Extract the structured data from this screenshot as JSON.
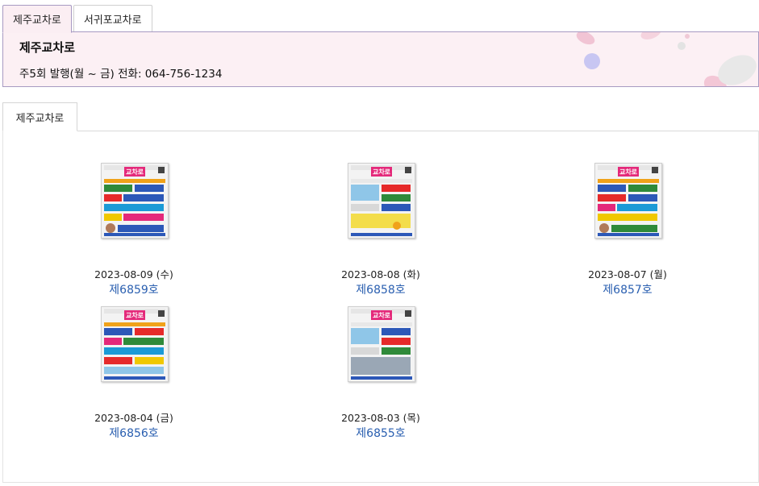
{
  "top_tabs": [
    {
      "label": "제주교차로",
      "active": true
    },
    {
      "label": "서귀포교차로",
      "active": false
    }
  ],
  "info": {
    "title": "제주교차로",
    "description": "주5회 발행(월 ~ 금) 전화: 064-756-1234"
  },
  "sub_tabs": [
    {
      "label": "제주교차로",
      "active": true
    }
  ],
  "issues": [
    {
      "date": "2023-08-09 (수)",
      "number": "제6859호",
      "cover_logo": "교차로"
    },
    {
      "date": "2023-08-08 (화)",
      "number": "제6858호",
      "cover_logo": "교차로"
    },
    {
      "date": "2023-08-07 (월)",
      "number": "제6857호",
      "cover_logo": "교차로"
    },
    {
      "date": "2023-08-04 (금)",
      "number": "제6856호",
      "cover_logo": "교차로"
    },
    {
      "date": "2023-08-03 (목)",
      "number": "제6855호",
      "cover_logo": "교차로"
    }
  ],
  "colors": {
    "accent_border": "#a79ac2",
    "info_bg": "#fcf0f4",
    "link": "#2a5fb0",
    "logo": "#e4297a"
  }
}
